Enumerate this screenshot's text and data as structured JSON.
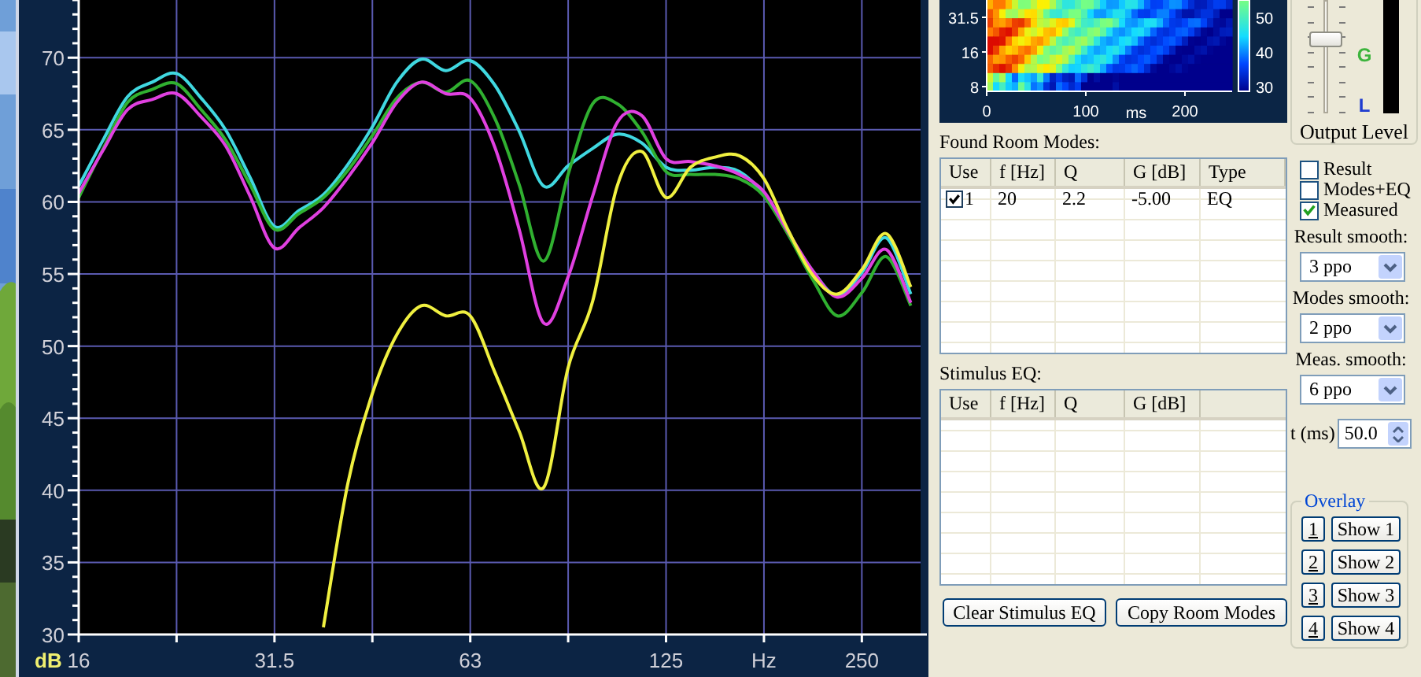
{
  "frequency_response": {
    "chart_data": {
      "type": "line",
      "xlabel": "Hz",
      "ylabel": "dB",
      "categories": [
        "16",
        null,
        null,
        null,
        null,
        null,
        null,
        null,
        "31.5",
        null,
        null,
        null,
        null,
        null,
        null,
        null,
        "63",
        null,
        null,
        null,
        null,
        null,
        null,
        null,
        "125",
        null,
        null,
        null,
        null,
        null,
        null,
        null,
        "250",
        null,
        null
      ],
      "series": [
        {
          "color": "#40d8e0",
          "values": [
            61.1,
            64.3,
            67.3,
            68.3,
            68.9,
            67.2,
            65.0,
            61.7,
            58.3,
            59.4,
            60.5,
            62.6,
            65.2,
            68.3,
            69.9,
            69.1,
            69.8,
            68.1,
            64.9,
            61.1,
            62.5,
            63.7,
            64.7,
            64.1,
            62.4,
            62.2,
            62.4,
            62.1,
            60.5,
            57.8,
            55.2,
            53.5,
            55.1,
            57.5,
            53.6
          ]
        },
        {
          "color": "#30b030",
          "values": [
            60.3,
            63.7,
            66.9,
            67.8,
            68.2,
            66.4,
            64.3,
            61.2,
            58.1,
            59.2,
            60.3,
            62.2,
            64.6,
            67.2,
            68.3,
            67.6,
            68.4,
            65.8,
            61.2,
            55.9,
            61.9,
            66.8,
            66.8,
            64.9,
            62.1,
            61.9,
            61.9,
            61.6,
            60.4,
            57.7,
            54.6,
            52.1,
            53.7,
            56.2,
            52.8
          ]
        },
        {
          "color": "#e040e0",
          "values": [
            60.6,
            63.6,
            66.4,
            67.1,
            67.5,
            65.9,
            63.9,
            60.4,
            56.8,
            58.2,
            59.6,
            61.7,
            64.1,
            66.9,
            68.3,
            67.5,
            67.2,
            63.8,
            58.1,
            51.6,
            54.8,
            60.4,
            65.5,
            66.0,
            63.0,
            62.8,
            62.5,
            61.9,
            60.7,
            57.9,
            55.2,
            53.4,
            54.7,
            56.7,
            53.0
          ]
        },
        {
          "color": "#f0f040",
          "values": [
            null,
            null,
            null,
            null,
            null,
            null,
            null,
            null,
            null,
            null,
            30.5,
            40.5,
            46.7,
            50.8,
            52.8,
            52.1,
            52.1,
            48.2,
            44.1,
            40.2,
            48.5,
            53.1,
            61.1,
            63.5,
            60.3,
            62.4,
            63.1,
            63.2,
            61.6,
            58.0,
            54.9,
            53.6,
            55.3,
            57.8,
            54.1
          ]
        }
      ],
      "ylim": [
        30,
        74
      ],
      "yticks": [
        30,
        35,
        40,
        45,
        50,
        55,
        60,
        65,
        70
      ],
      "grid": true
    }
  },
  "decay_spectrogram": {
    "y_labels": [
      "31.5",
      "16",
      "8"
    ],
    "x_labels": [
      "0",
      "100",
      "200"
    ],
    "x_unit": "ms",
    "colorbar_labels": [
      "50",
      "40",
      "30"
    ]
  },
  "output_level": {
    "label": "Output Level",
    "slider": {
      "level": 0.68
    },
    "meter_labels": [
      "G",
      "L"
    ]
  },
  "found_room_modes": {
    "title": "Found Room Modes:",
    "columns": [
      "Use",
      "f [Hz]",
      "Q",
      "G [dB]",
      "Type"
    ],
    "rows": [
      {
        "checked": true,
        "cells": [
          "1",
          "20",
          "2.2",
          "-5.00",
          "EQ"
        ]
      }
    ]
  },
  "display_options": [
    {
      "label": "Result",
      "checked": false
    },
    {
      "label": "Modes+EQ",
      "checked": false
    },
    {
      "label": "Measured",
      "checked": true
    }
  ],
  "smoothing": [
    {
      "label": "Result smooth:",
      "value": "3 ppo"
    },
    {
      "label": "Modes smooth:",
      "value": "2 ppo"
    },
    {
      "label": "Meas. smooth:",
      "value": "6 ppo"
    }
  ],
  "time_window": {
    "label": "t (ms)",
    "value": "50.0"
  },
  "stimulus_eq": {
    "title": "Stimulus EQ:",
    "columns": [
      "Use",
      "f [Hz]",
      "Q",
      "G [dB]"
    ]
  },
  "overlay": {
    "title": "Overlay",
    "rows": [
      {
        "number": "1",
        "button": "Show 1"
      },
      {
        "number": "2",
        "button": "Show 2"
      },
      {
        "number": "3",
        "button": "Show 3"
      },
      {
        "number": "4",
        "button": "Show 4"
      }
    ]
  },
  "buttons": [
    "Clear Stimulus EQ",
    "Copy Room Modes"
  ]
}
